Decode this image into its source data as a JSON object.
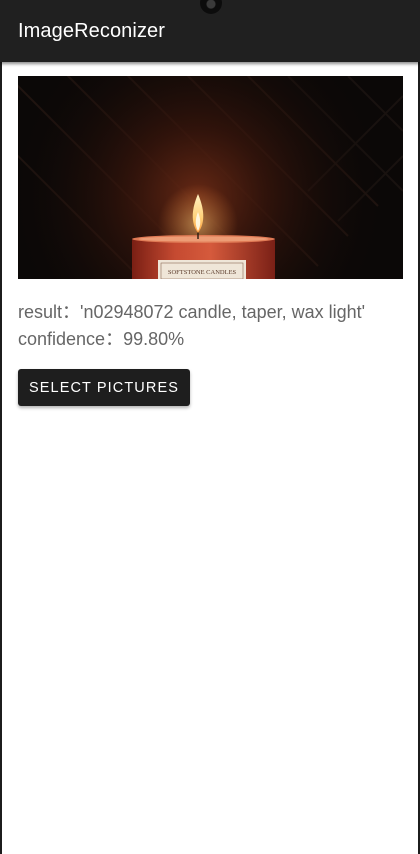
{
  "app_bar": {
    "title": "ImageReconizer"
  },
  "photo": {
    "subject": "candle-photo",
    "label_text": "SOFTSTONE CANDLES"
  },
  "result": {
    "label": "result",
    "separator": "：",
    "value": "'n02948072 candle, taper, wax light'"
  },
  "confidence": {
    "label": "confidence",
    "separator": "：",
    "value": "99.80%"
  },
  "actions": {
    "select_pictures": "SELECT PICTURES"
  },
  "colors": {
    "app_bar": "#202020",
    "background": "#ffffff",
    "button": "#1e1e1e",
    "text_secondary": "#666666",
    "candle": "#c0402c",
    "flame": "#ffd27a"
  }
}
